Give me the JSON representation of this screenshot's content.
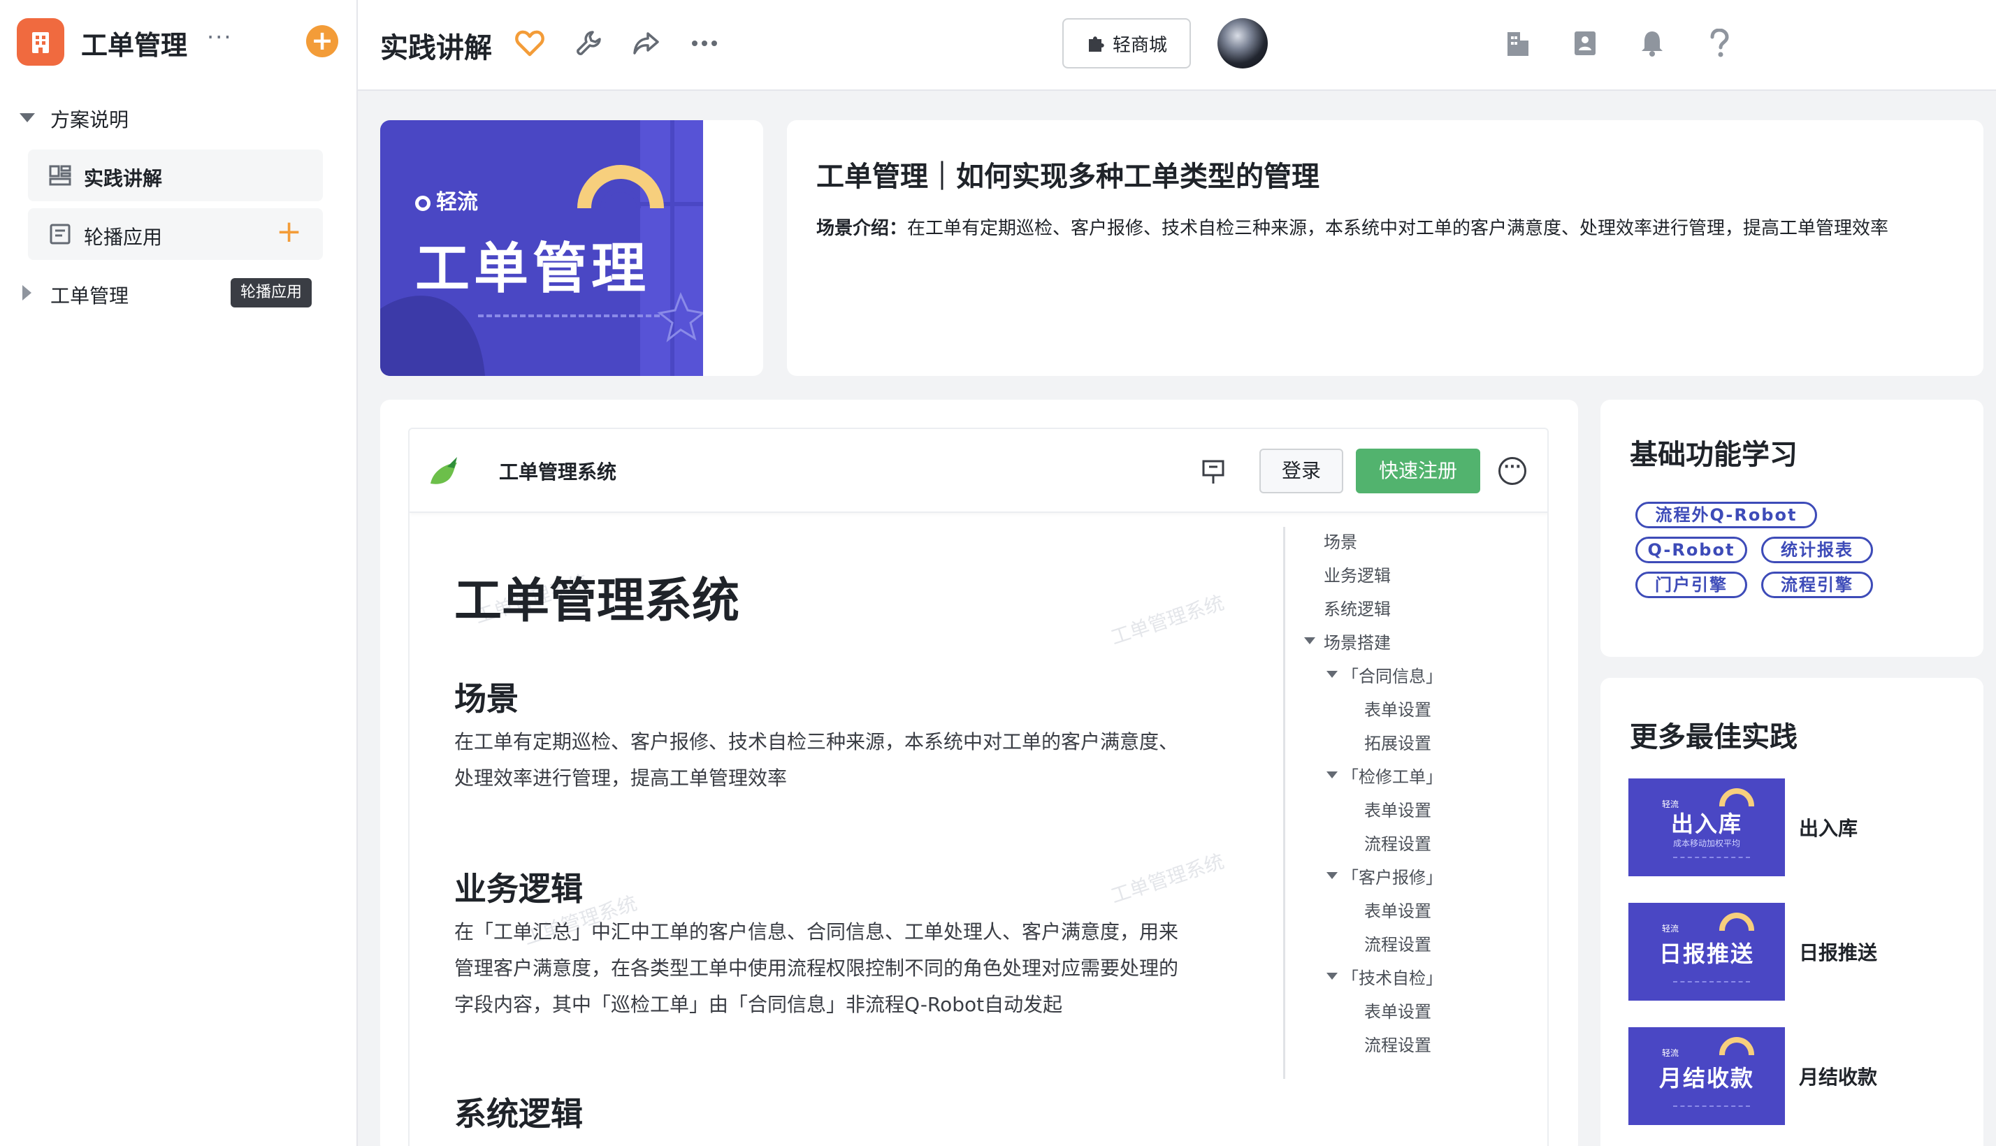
{
  "app": {
    "title": "工单管理",
    "more": "···",
    "add": "+"
  },
  "sidebar": {
    "groups": [
      {
        "label": "方案说明",
        "expanded": true
      },
      {
        "label": "工单管理",
        "expanded": false
      }
    ],
    "items": [
      {
        "label": "实践讲解",
        "active": true
      },
      {
        "label": "轮播应用",
        "add": "+"
      }
    ],
    "tooltip": "轮播应用"
  },
  "header": {
    "title": "实践讲解",
    "store_label": "轻商城"
  },
  "banner": {
    "logo": "轻流",
    "title": "工单管理"
  },
  "intro": {
    "title": "工单管理｜如何实现多种工单类型的管理",
    "prefix": "场景介绍：",
    "text": "在工单有定期巡检、客户报修、技术自检三种来源，本系统中对工单的客户满意度、处理效率进行管理，提高工单管理效率"
  },
  "embedded_app": {
    "name": "工单管理系统",
    "login": "登录",
    "signup": "快速注册",
    "doc": {
      "h1": "工单管理系统",
      "sections": [
        {
          "heading": "场景",
          "text": "在工单有定期巡检、客户报修、技术自检三种来源，本系统中对工单的客户满意度、处理效率进行管理，提高工单管理效率"
        },
        {
          "heading": "业务逻辑",
          "text": "在「工单汇总」中汇中工单的客户信息、合同信息、工单处理人、客户满意度，用来管理客户满意度，在各类型工单中使用流程权限控制不同的角色处理对应需要处理的字段内容，其中「巡检工单」由「合同信息」非流程Q-Robot自动发起"
        },
        {
          "heading": "系统逻辑",
          "text": ""
        }
      ],
      "watermark": "工单管理系统"
    },
    "toc": [
      "场景",
      "业务逻辑",
      "系统逻辑",
      "场景搭建",
      "「合同信息」",
      "表单设置",
      "拓展设置",
      "「检修工单」",
      "表单设置",
      "流程设置",
      "「客户报修」",
      "表单设置",
      "流程设置",
      "「技术自检」",
      "表单设置",
      "流程设置"
    ]
  },
  "learn": {
    "title": "基础功能学习",
    "tags": [
      "流程外Q-Robot",
      "Q-Robot",
      "统计报表",
      "门户引擎",
      "流程引擎"
    ]
  },
  "more": {
    "title": "更多最佳实践",
    "items": [
      {
        "thumb_title": "出入库",
        "thumb_sub": "成本移动加权平均",
        "label": "出入库"
      },
      {
        "thumb_title": "日报推送",
        "thumb_sub": "",
        "label": "日报推送"
      },
      {
        "thumb_title": "月结收款",
        "thumb_sub": "",
        "label": "月结收款"
      }
    ],
    "thumb_logo": "轻流"
  },
  "colors": {
    "accent": "#f39c38",
    "brand_purple": "#4a47c4",
    "green": "#52b36e",
    "tag_blue": "#3d4bb8"
  }
}
